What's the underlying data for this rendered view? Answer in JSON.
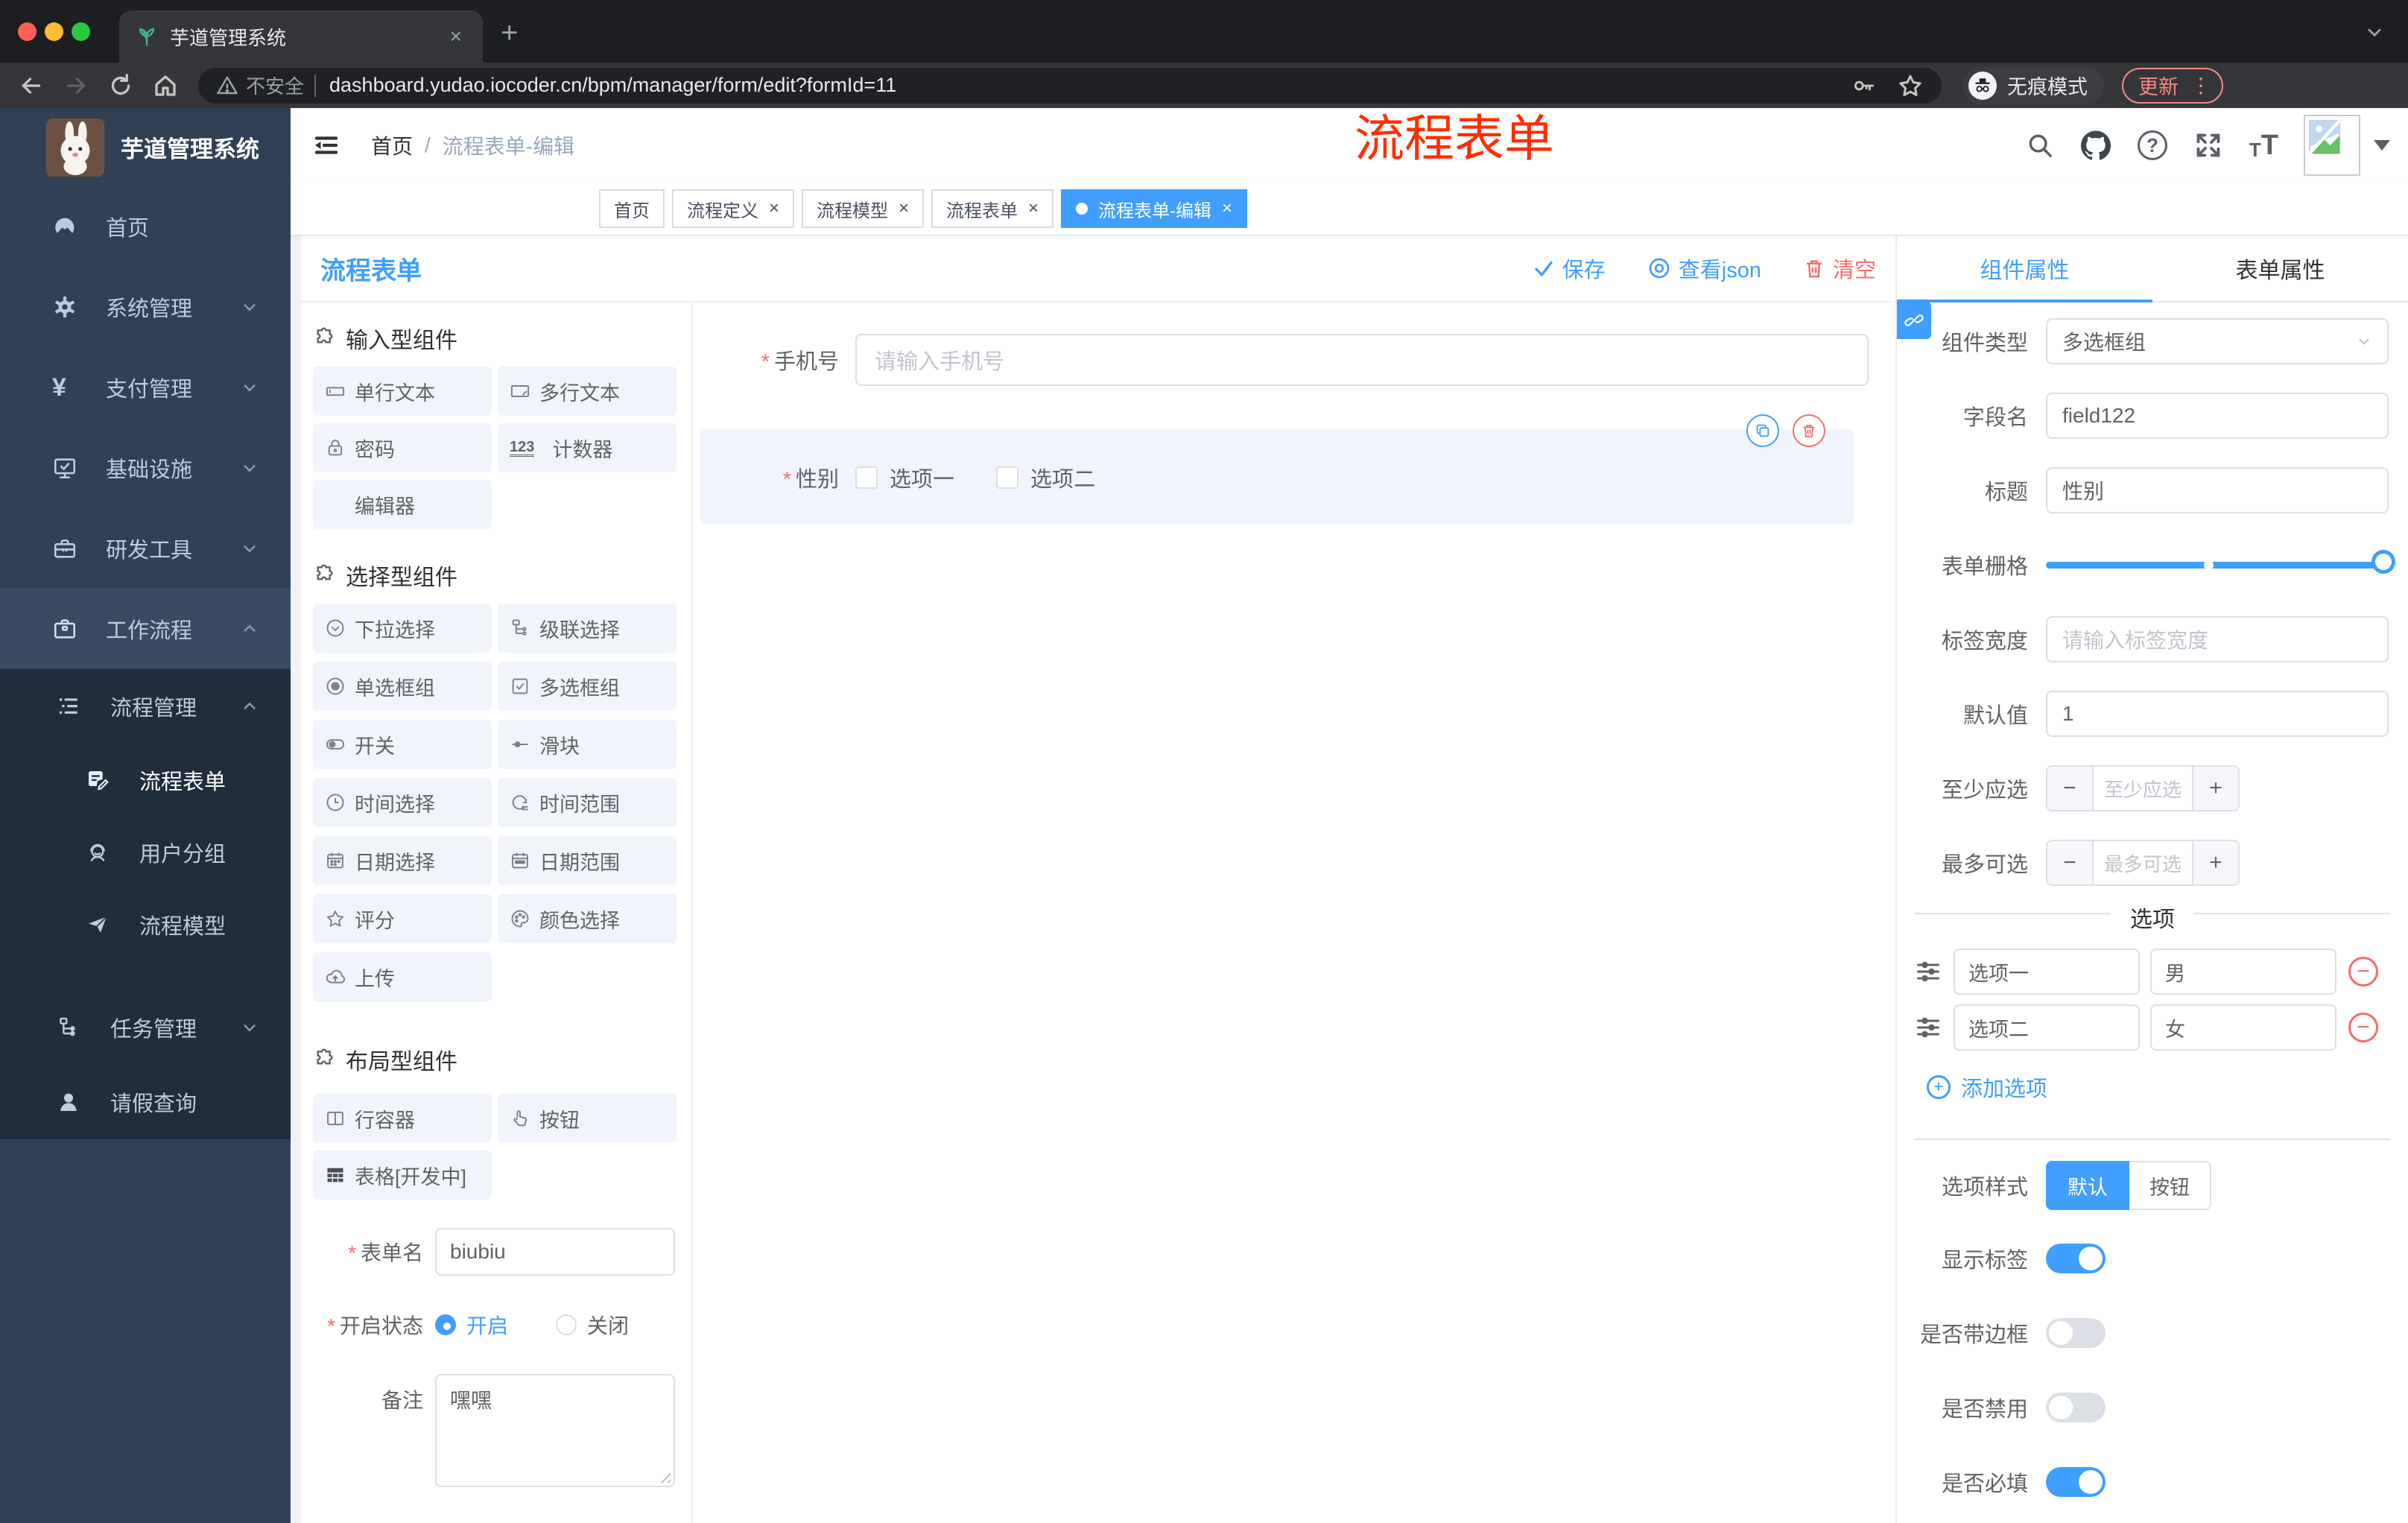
{
  "colors": {
    "accent": "#409EFF",
    "danger": "#F56C6C",
    "annotation_red": "#FF2D00",
    "sidebar_bg": "#304156",
    "submenu_bg": "#1f2d3d"
  },
  "glyphs": {
    "close": "×",
    "plus": "+",
    "minus": "−",
    "dots": "⋮",
    "asterisk": "*",
    "slash": "/",
    "ellipsis": "⋮"
  },
  "icons": {
    "counter": "123",
    "yen": "¥",
    "question": "?",
    "text_size_small": "T",
    "text_size_big": "T"
  },
  "browser": {
    "tab_title": "芋道管理系统",
    "security_label": "不安全",
    "url": "dashboard.yudao.iocoder.cn/bpm/manager/form/edit?formId=11",
    "incognito_label": "无痕模式",
    "update_label": "更新"
  },
  "annotation": {
    "text": "流程表单"
  },
  "sidebar": {
    "logo_title": "芋道管理系统",
    "items": [
      {
        "label": "首页"
      },
      {
        "label": "系统管理"
      },
      {
        "label": "支付管理"
      },
      {
        "label": "基础设施"
      },
      {
        "label": "研发工具"
      },
      {
        "label": "工作流程"
      }
    ],
    "submenu": [
      {
        "label": "流程管理"
      },
      {
        "label": "流程表单"
      },
      {
        "label": "用户分组"
      },
      {
        "label": "流程模型"
      },
      {
        "label": "任务管理"
      },
      {
        "label": "请假查询"
      }
    ]
  },
  "navbar": {
    "breadcrumb_home": "首页",
    "breadcrumb_current": "流程表单-编辑"
  },
  "tags": [
    {
      "label": "首页"
    },
    {
      "label": "流程定义"
    },
    {
      "label": "流程模型"
    },
    {
      "label": "流程表单"
    },
    {
      "label": "流程表单-编辑"
    }
  ],
  "board": {
    "title": "流程表单",
    "actions": {
      "save": "保存",
      "view_json": "查看json",
      "clear": "清空"
    },
    "palette": {
      "sections": [
        {
          "title": "输入型组件"
        },
        {
          "title": "选择型组件"
        },
        {
          "title": "布局型组件"
        }
      ],
      "input_items": [
        {
          "label": "单行文本"
        },
        {
          "label": "多行文本"
        },
        {
          "label": "密码"
        },
        {
          "label": "计数器"
        },
        {
          "label": "编辑器"
        }
      ],
      "select_items": [
        {
          "label": "下拉选择"
        },
        {
          "label": "级联选择"
        },
        {
          "label": "单选框组"
        },
        {
          "label": "多选框组"
        },
        {
          "label": "开关"
        },
        {
          "label": "滑块"
        },
        {
          "label": "时间选择"
        },
        {
          "label": "时间范围"
        },
        {
          "label": "日期选择"
        },
        {
          "label": "日期范围"
        },
        {
          "label": "评分"
        },
        {
          "label": "颜色选择"
        },
        {
          "label": "上传"
        }
      ],
      "layout_items": [
        {
          "label": "行容器"
        },
        {
          "label": "按钮"
        },
        {
          "label": "表格[开发中]"
        }
      ]
    },
    "meta": {
      "name_label": "表单名",
      "name_value": "biubiu",
      "status_label": "开启状态",
      "status_on": "开启",
      "status_off": "关闭",
      "remark_label": "备注",
      "remark_value": "嘿嘿"
    }
  },
  "canvas": {
    "phone": {
      "label": "手机号",
      "placeholder": "请输入手机号"
    },
    "gender": {
      "label": "性别",
      "option1": "选项一",
      "option2": "选项二"
    }
  },
  "props": {
    "tab_component": "组件属性",
    "tab_form": "表单属性",
    "component_type_label": "组件类型",
    "component_type_value": "多选框组",
    "field_name_label": "字段名",
    "field_name_value": "field122",
    "title_label": "标题",
    "title_value": "性别",
    "grid_label": "表单栅格",
    "label_width_label": "标签宽度",
    "label_width_placeholder": "请输入标签宽度",
    "default_label": "默认值",
    "default_value": "1",
    "min_label": "至少应选",
    "min_placeholder": "至少应选",
    "max_label": "最多可选",
    "max_placeholder": "最多可选",
    "options_title": "选项",
    "options": [
      {
        "label": "选项一",
        "value": "男"
      },
      {
        "label": "选项二",
        "value": "女"
      }
    ],
    "add_option": "添加选项",
    "style_label": "选项样式",
    "style_default": "默认",
    "style_button": "按钮",
    "show_label": "显示标签",
    "border_label": "是否带边框",
    "disabled_label": "是否禁用",
    "required_label": "是否必填"
  }
}
